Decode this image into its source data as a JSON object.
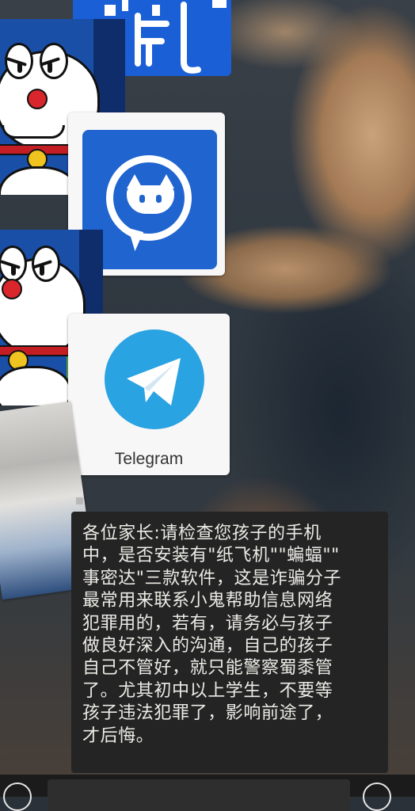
{
  "apps": {
    "telegram": {
      "label": "Telegram"
    }
  },
  "message": {
    "text": "各位家长:请检查您孩子的手机\n中，是否安装有\"纸飞机\"\"蝙蝠\"\"\n事密达\"三款软件，这是诈骗分子\n最常用来联系小鬼帮助信息网络\n犯罪用的，若有，请务必与孩子\n做良好深入的沟通，自己的孩子\n自己不管好，就只能警察蜀黍管\n了。尤其初中以上学生，不要等\n孩子违法犯罪了，影响前途了，\n才后悔。"
  },
  "icons": {
    "app1": "bat-chat-icon",
    "app2": "telegram-icon",
    "voice": "voice-icon",
    "emoji": "emoji-icon"
  },
  "colors": {
    "bubble": "#242424",
    "telegram_blue": "#2aa3e2",
    "bat_blue": "#1f64cf",
    "doraemon_blue": "#1e6cc7"
  }
}
